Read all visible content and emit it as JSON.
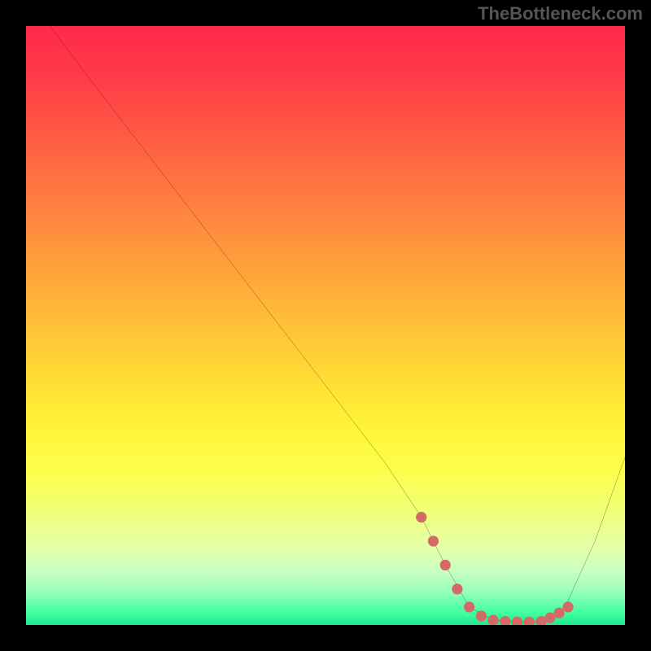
{
  "watermark": "TheBottleneck.com",
  "chart_data": {
    "type": "line",
    "title": "",
    "xlabel": "",
    "ylabel": "",
    "xlim": [
      0,
      100
    ],
    "ylim": [
      0,
      100
    ],
    "grid": false,
    "legend": false,
    "background": "vertical-gradient red→orange→yellow→green",
    "series": [
      {
        "name": "curve",
        "color": "#000000",
        "x": [
          4,
          10,
          20,
          30,
          40,
          50,
          60,
          66,
          70,
          74,
          78,
          82,
          86,
          90,
          95,
          100
        ],
        "y": [
          100,
          92,
          79,
          66,
          53,
          40,
          27,
          18,
          10,
          3,
          0.8,
          0.5,
          0.6,
          3,
          14,
          28
        ]
      },
      {
        "name": "highlight-dots",
        "color": "#d46a68",
        "type": "scatter",
        "x": [
          66,
          68,
          70,
          72,
          74,
          76,
          78,
          80,
          82,
          84,
          86,
          87.5,
          89,
          90.5
        ],
        "y": [
          18,
          14,
          10,
          6,
          3,
          1.5,
          0.8,
          0.6,
          0.5,
          0.5,
          0.6,
          1.2,
          2,
          3
        ]
      }
    ],
    "annotations": []
  }
}
